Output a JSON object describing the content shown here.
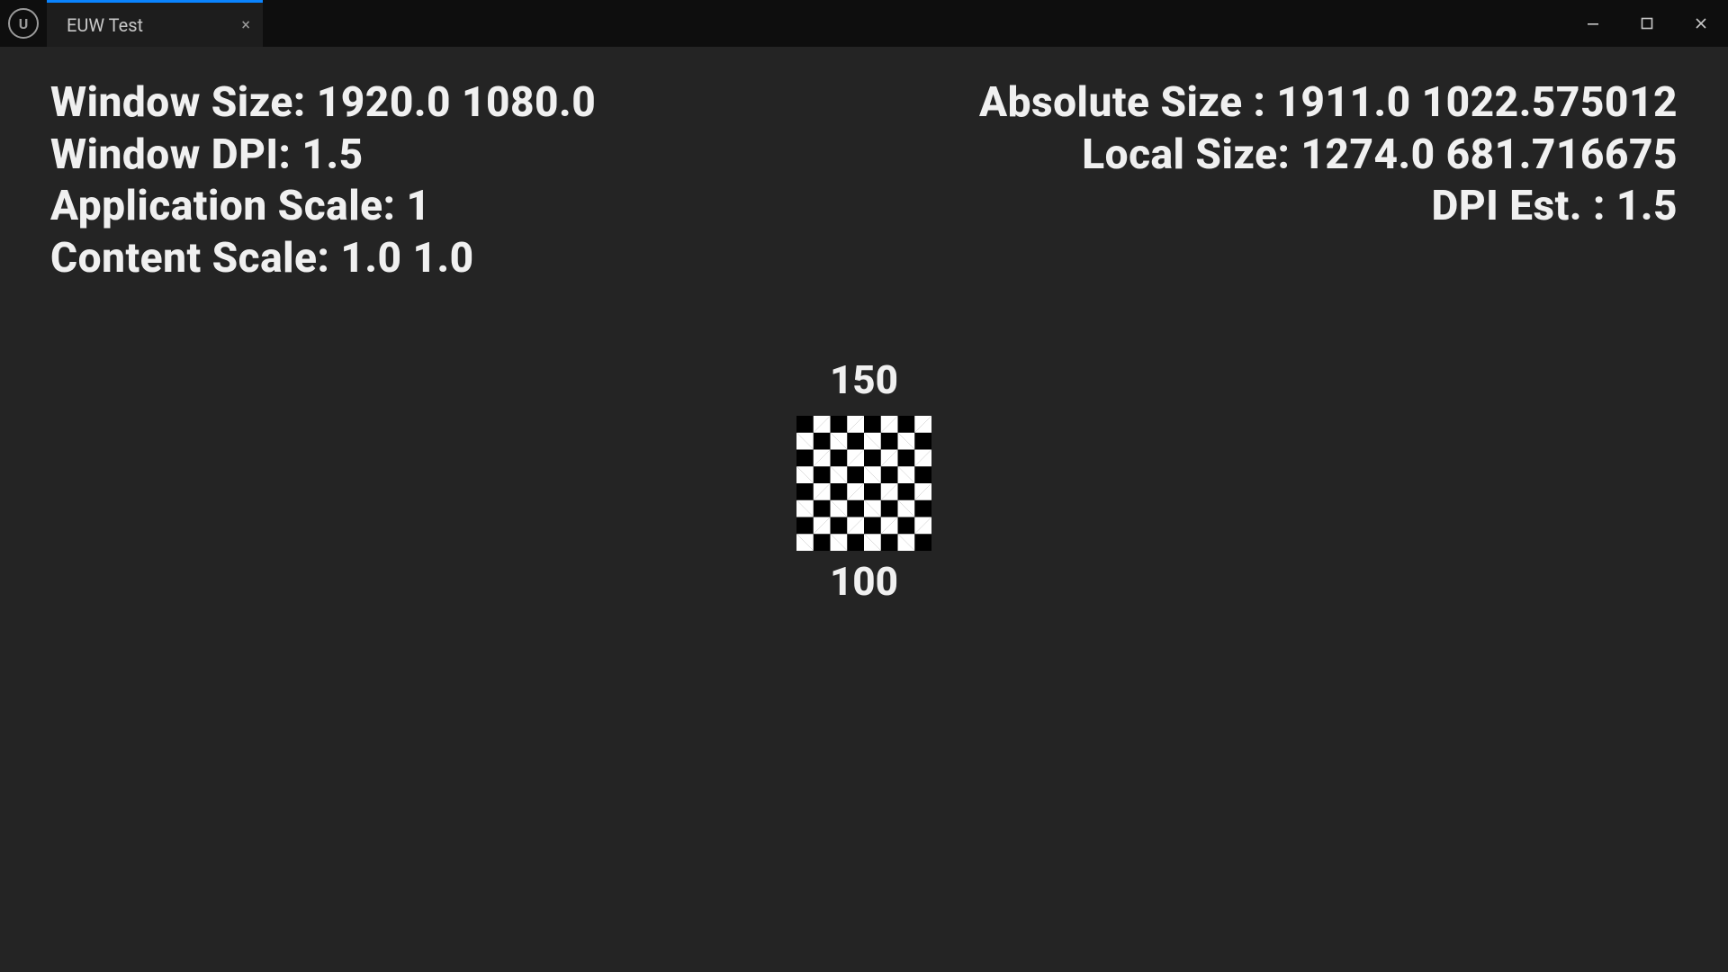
{
  "titlebar": {
    "app_icon_letter": "U",
    "tab_label": "EUW Test",
    "close_glyph": "×",
    "minimize_title": "Minimize",
    "maximize_title": "Maximize",
    "close_title": "Close"
  },
  "left_panel": {
    "window_size_label": "Window Size:",
    "window_size_value": "1920.0 1080.0",
    "window_dpi_label": "Window DPI:",
    "window_dpi_value": "1.5",
    "app_scale_label": "Application Scale:",
    "app_scale_value": "1",
    "content_scale_label": "Content Scale:",
    "content_scale_value": "1.0 1.0"
  },
  "right_panel": {
    "absolute_size_label": "Absolute Size :",
    "absolute_size_value": "1911.0 1022.575012",
    "local_size_label": "Local Size:",
    "local_size_value": "1274.0 681.716675",
    "dpi_est_label": "DPI Est. :",
    "dpi_est_value": "1.5"
  },
  "center": {
    "top_number": "150",
    "bottom_number": "100"
  }
}
